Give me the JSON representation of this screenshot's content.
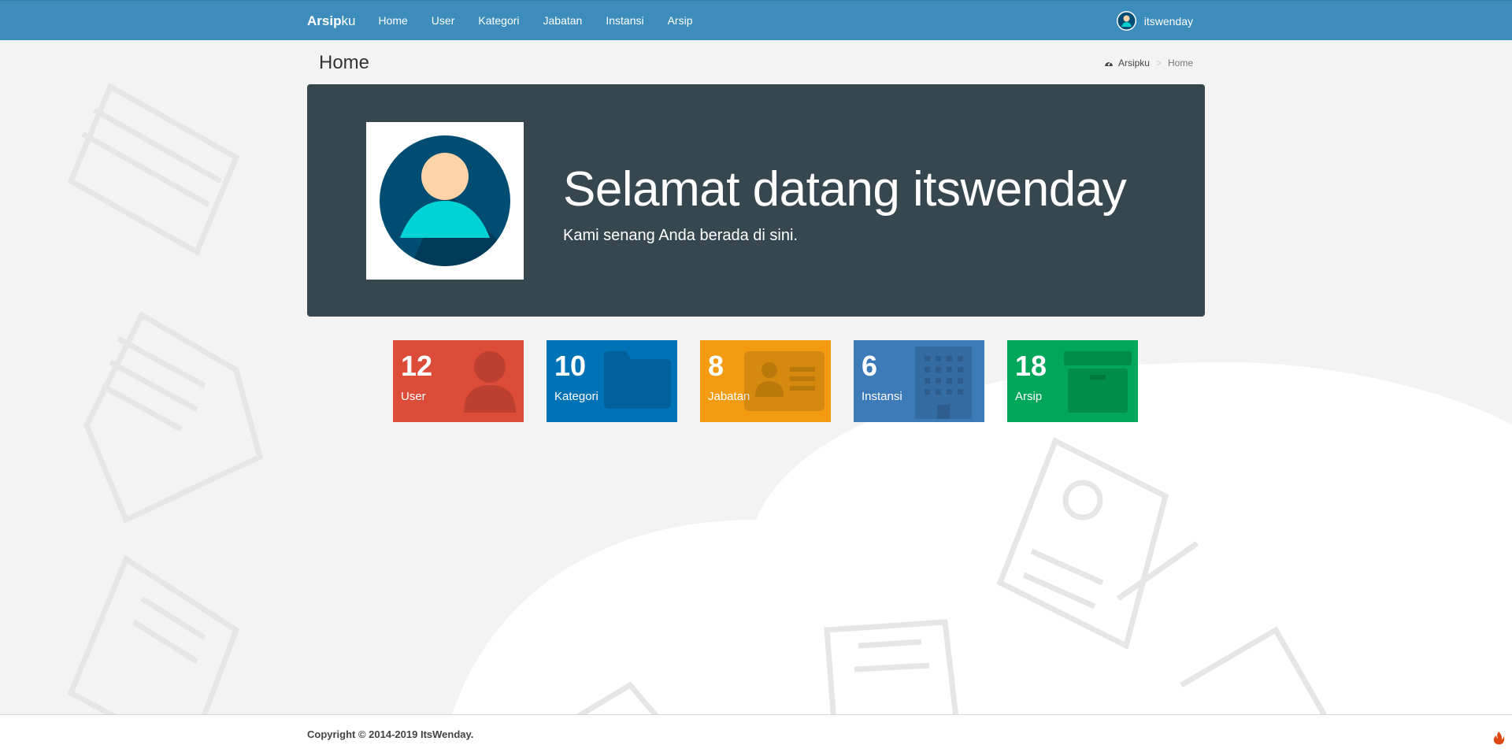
{
  "navbar": {
    "brand_bold": "Arsip",
    "brand_light": "ku",
    "links": [
      "Home",
      "User",
      "Kategori",
      "Jabatan",
      "Instansi",
      "Arsip"
    ],
    "username": "itswenday"
  },
  "header": {
    "title": "Home",
    "breadcrumb_root": "Arsipku",
    "breadcrumb_current": "Home"
  },
  "jumbotron": {
    "title": "Selamat datang itswenday",
    "subtitle": "Kami senang Anda berada di sini."
  },
  "stats": [
    {
      "value": "12",
      "label": "User",
      "color": "#dd4b39",
      "icon": "user-icon"
    },
    {
      "value": "10",
      "label": "Kategori",
      "color": "#0073b7",
      "icon": "folder-icon"
    },
    {
      "value": "8",
      "label": "Jabatan",
      "color": "#f39c12",
      "icon": "id-card-icon"
    },
    {
      "value": "6",
      "label": "Instansi",
      "color": "#3c8dbc",
      "icon": "building-icon"
    },
    {
      "value": "18",
      "label": "Arsip",
      "color": "#00a65a",
      "icon": "archive-icon"
    }
  ],
  "footer": {
    "copyright": "Copyright © 2014-2019 ItsWenday."
  },
  "colors": {
    "navbar": "#3c8dbc",
    "jumbotron": "#37474f",
    "background": "#f3f3f3"
  }
}
